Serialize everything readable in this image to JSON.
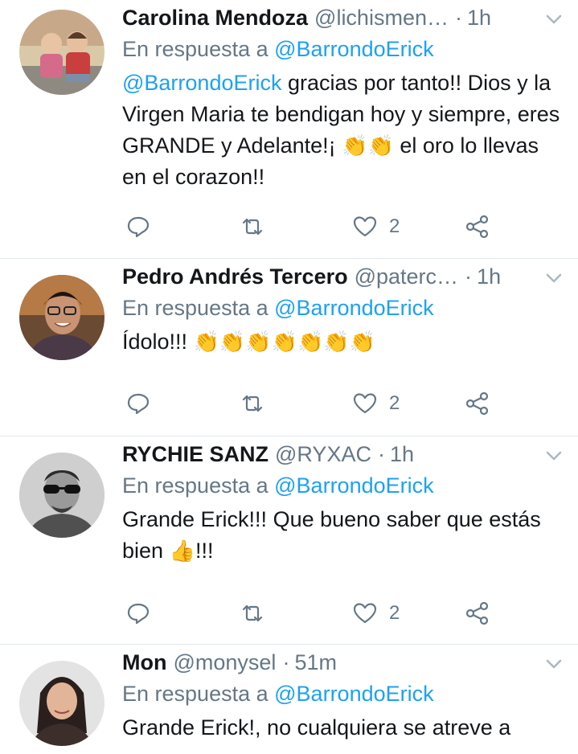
{
  "tweets": [
    {
      "name": "Carolina Mendoza",
      "handle": "@lichismen…",
      "sep": "·",
      "time": "1h",
      "reply_prefix": "En respuesta a",
      "reply_to": "@BarrondoErick",
      "text_mention": "@BarrondoErick",
      "text_1": " gracias por tanto!! Dios y la Virgen Maria te bendigan hoy y siempre, eres GRANDE y Adelante!¡ ",
      "emoji_1": "👏👏",
      "text_2": " el oro lo llevas en el corazon!!",
      "likes": "2"
    },
    {
      "name": "Pedro Andrés Tercero",
      "handle": "@paterc…",
      "sep": "·",
      "time": "1h",
      "reply_prefix": "En respuesta a",
      "reply_to": "@BarrondoErick",
      "text_1": "Ídolo!!! ",
      "emoji_1": "👏👏👏👏👏👏👏",
      "likes": "2"
    },
    {
      "name": "RYCHIE SANZ",
      "handle": "@RYXAC",
      "sep": "·",
      "time": "1h",
      "reply_prefix": "En respuesta a",
      "reply_to": "@BarrondoErick",
      "text_1": "Grande Erick!!! Que bueno saber que estás bien ",
      "emoji_1": "👍",
      "text_2": "!!!",
      "likes": "2"
    },
    {
      "name": "Mon",
      "handle": "@monysel",
      "sep": "·",
      "time": "51m",
      "reply_prefix": "En respuesta a",
      "reply_to": "@BarrondoErick",
      "text_1": "Grande Erick!, no cualquiera se atreve a"
    }
  ],
  "icons": {
    "reply": "reply-icon",
    "retweet": "retweet-icon",
    "like": "heart-icon",
    "share": "share-icon",
    "caret": "chevron-down-icon"
  },
  "colors": {
    "link": "#1da1f2",
    "secondary": "#657786",
    "text": "#14171a",
    "divider": "#e1e8ed"
  }
}
